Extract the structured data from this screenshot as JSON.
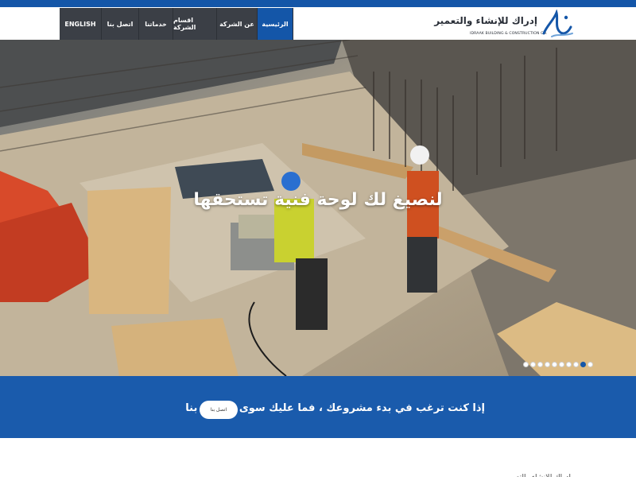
{
  "nav": {
    "items": [
      {
        "label": "ENGLISH",
        "active": false
      },
      {
        "label": "اتصل بنا",
        "active": false
      },
      {
        "label": "خدماتنا",
        "active": false
      },
      {
        "label": "اقسام الشركة",
        "active": false
      },
      {
        "label": "عن الشركة",
        "active": false
      },
      {
        "label": "الرئيسية",
        "active": true
      }
    ]
  },
  "logo": {
    "arabic": "إدراك للإنشاء والتعمير",
    "english": "IDRAAK BUILDING & CONSTRUCTION CO."
  },
  "hero": {
    "headline": "لنصيغ لك لوحة فنية تستحقها",
    "slide_count": 10,
    "active_slide": 9
  },
  "cta": {
    "text": "إذا كنت ترغب في بدء مشروعك ، فما عليك سوى الاتصل بنا",
    "button_label": "اتصل بنا"
  },
  "bottom": {
    "partial_text": "إدراك للإنشاء والتعمير"
  },
  "colors": {
    "primary_blue": "#1456a8",
    "nav_dark": "#3b3f46",
    "cta_blue": "#1a5bac"
  }
}
